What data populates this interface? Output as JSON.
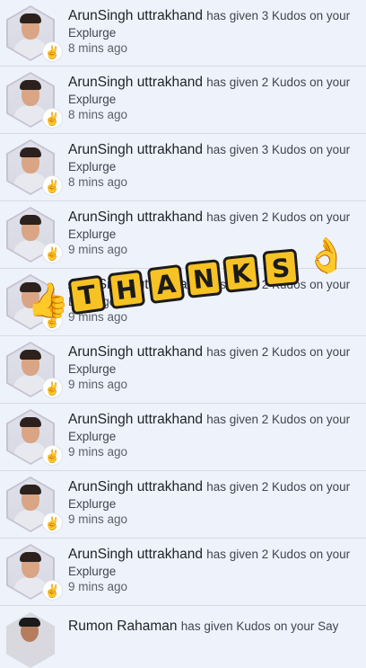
{
  "notifications": [
    {
      "name": "ArunSingh uttrakhand",
      "action": "has given 3 Kudos on your",
      "target": "Explurge",
      "time": "8 mins ago"
    },
    {
      "name": "ArunSingh uttrakhand",
      "action": "has given 2 Kudos on your",
      "target": "Explurge",
      "time": "8 mins ago"
    },
    {
      "name": "ArunSingh uttrakhand",
      "action": "has given 3 Kudos on your",
      "target": "Explurge",
      "time": "8 mins ago"
    },
    {
      "name": "ArunSingh uttrakhand",
      "action": "has given 2 Kudos on your",
      "target": "Explurge",
      "time": "9 mins ago"
    },
    {
      "name": "ArunSingh uttrakhand",
      "action": "has given 2 Kudos on your",
      "target": "Explurge",
      "time": "9 mins ago"
    },
    {
      "name": "ArunSingh uttrakhand",
      "action": "has given 2 Kudos on your",
      "target": "Explurge",
      "time": "9 mins ago"
    },
    {
      "name": "ArunSingh uttrakhand",
      "action": "has given 2 Kudos on your",
      "target": "Explurge",
      "time": "9 mins ago"
    },
    {
      "name": "ArunSingh uttrakhand",
      "action": "has given 2 Kudos on your",
      "target": "Explurge",
      "time": "9 mins ago"
    },
    {
      "name": "ArunSingh uttrakhand",
      "action": "has given 2 Kudos on your",
      "target": "Explurge",
      "time": "9 mins ago"
    }
  ],
  "last_notification": {
    "name": "Rumon Rahaman",
    "action": "has given Kudos on your Say"
  },
  "overlay": {
    "letters": [
      "T",
      "H",
      "A",
      "N",
      "K",
      "S"
    ],
    "thumb_icon": "thumbs-up-emoji",
    "ok_icon": "ok-hand-emoji"
  },
  "badge_icon": "kudos-hand-icon",
  "colors": {
    "background": "#eef2fa",
    "tile": "#f6c224",
    "badge": "#3e76d6"
  }
}
